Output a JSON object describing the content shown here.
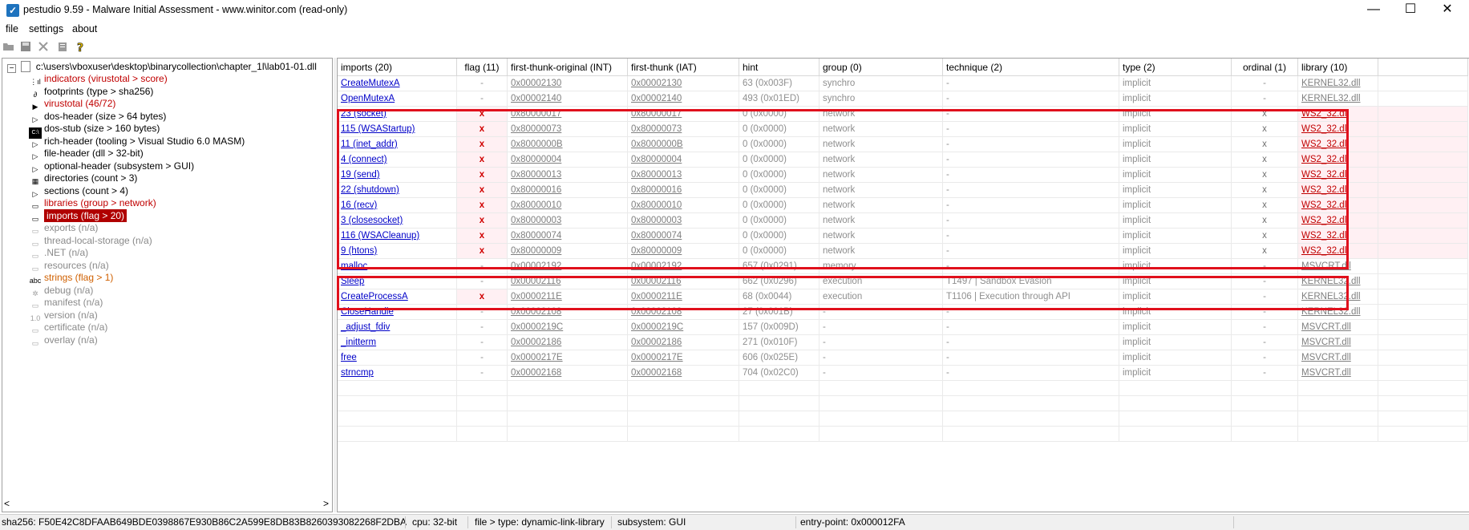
{
  "window": {
    "title": "pestudio 9.59 - Malware Initial Assessment - www.winitor.com (read-only)",
    "minimize": "—",
    "maximize": "☐",
    "close": "✕"
  },
  "menu": [
    "file",
    "settings",
    "about"
  ],
  "toolbar_icons": [
    "open-folder-icon",
    "save-icon",
    "close-file-icon",
    "clipboard-icon",
    "help-icon"
  ],
  "tree": {
    "root": "c:\\users\\vboxuser\\desktop\\binarycollection\\chapter_1l\\lab01-01.dll",
    "items": [
      {
        "label": "indicators (virustotal > score)",
        "style": "red",
        "icon": "indicators-icon"
      },
      {
        "label": "footprints (type > sha256)",
        "style": "normal",
        "icon": "footprints-icon"
      },
      {
        "label": "virustotal (46/72)",
        "style": "red",
        "icon": "virustotal-icon"
      },
      {
        "label": "dos-header (size > 64 bytes)",
        "style": "normal",
        "icon": "expand-arrow-icon"
      },
      {
        "label": "dos-stub (size > 160 bytes)",
        "style": "normal",
        "icon": "dos-stub-icon"
      },
      {
        "label": "rich-header (tooling > Visual Studio 6.0 MASM)",
        "style": "normal",
        "icon": "expand-arrow-icon"
      },
      {
        "label": "file-header (dll > 32-bit)",
        "style": "normal",
        "icon": "expand-arrow-icon"
      },
      {
        "label": "optional-header (subsystem > GUI)",
        "style": "normal",
        "icon": "expand-arrow-icon"
      },
      {
        "label": "directories (count > 3)",
        "style": "normal",
        "icon": "directories-icon"
      },
      {
        "label": "sections (count > 4)",
        "style": "normal",
        "icon": "expand-arrow-icon"
      },
      {
        "label": "libraries (group > network)",
        "style": "red",
        "icon": "libraries-icon"
      },
      {
        "label": "imports (flag > 20)",
        "style": "selected",
        "icon": "imports-icon"
      },
      {
        "label": "exports (n/a)",
        "style": "gray",
        "icon": "exports-icon"
      },
      {
        "label": "thread-local-storage (n/a)",
        "style": "gray",
        "icon": "tls-icon"
      },
      {
        "label": ".NET (n/a)",
        "style": "gray",
        "icon": "dotnet-icon"
      },
      {
        "label": "resources (n/a)",
        "style": "gray",
        "icon": "resources-icon"
      },
      {
        "label": "strings (flag > 1)",
        "style": "orange",
        "icon": "strings-icon"
      },
      {
        "label": "debug (n/a)",
        "style": "gray",
        "icon": "debug-icon"
      },
      {
        "label": "manifest (n/a)",
        "style": "gray",
        "icon": "manifest-icon"
      },
      {
        "label": "version (n/a)",
        "style": "gray",
        "icon": "version-icon"
      },
      {
        "label": "certificate (n/a)",
        "style": "gray",
        "icon": "certificate-icon"
      },
      {
        "label": "overlay (n/a)",
        "style": "gray",
        "icon": "overlay-icon"
      }
    ],
    "scroll_left": "<",
    "scroll_right": ">"
  },
  "table": {
    "columns": [
      "imports (20)",
      "flag (11)",
      "first-thunk-original (INT)",
      "first-thunk (IAT)",
      "hint",
      "group (0)",
      "technique (2)",
      "type (2)",
      "ordinal (1)",
      "library (10)"
    ],
    "rows": [
      {
        "name": "CreateMutexA",
        "flag": "-",
        "int": "0x00002130",
        "iat": "0x00002130",
        "hint": "63 (0x003F)",
        "group": "synchro",
        "technique": "-",
        "type": "implicit",
        "ordinal": "-",
        "library": "KERNEL32.dll",
        "kind": "normal"
      },
      {
        "name": "OpenMutexA",
        "flag": "-",
        "int": "0x00002140",
        "iat": "0x00002140",
        "hint": "493 (0x01ED)",
        "group": "synchro",
        "technique": "-",
        "type": "implicit",
        "ordinal": "-",
        "library": "KERNEL32.dll",
        "kind": "normal"
      },
      {
        "name": "23 (socket)",
        "flag": "x",
        "int": "0x80000017",
        "iat": "0x80000017",
        "hint": "0 (0x0000)",
        "group": "network",
        "technique": "-",
        "type": "implicit",
        "ordinal": "x",
        "library": "WS2_32.dll",
        "kind": "network"
      },
      {
        "name": "115 (WSAStartup)",
        "flag": "x",
        "int": "0x80000073",
        "iat": "0x80000073",
        "hint": "0 (0x0000)",
        "group": "network",
        "technique": "-",
        "type": "implicit",
        "ordinal": "x",
        "library": "WS2_32.dll",
        "kind": "network"
      },
      {
        "name": "11 (inet_addr)",
        "flag": "x",
        "int": "0x8000000B",
        "iat": "0x8000000B",
        "hint": "0 (0x0000)",
        "group": "network",
        "technique": "-",
        "type": "implicit",
        "ordinal": "x",
        "library": "WS2_32.dll",
        "kind": "network"
      },
      {
        "name": "4 (connect)",
        "flag": "x",
        "int": "0x80000004",
        "iat": "0x80000004",
        "hint": "0 (0x0000)",
        "group": "network",
        "technique": "-",
        "type": "implicit",
        "ordinal": "x",
        "library": "WS2_32.dll",
        "kind": "network"
      },
      {
        "name": "19 (send)",
        "flag": "x",
        "int": "0x80000013",
        "iat": "0x80000013",
        "hint": "0 (0x0000)",
        "group": "network",
        "technique": "-",
        "type": "implicit",
        "ordinal": "x",
        "library": "WS2_32.dll",
        "kind": "network"
      },
      {
        "name": "22 (shutdown)",
        "flag": "x",
        "int": "0x80000016",
        "iat": "0x80000016",
        "hint": "0 (0x0000)",
        "group": "network",
        "technique": "-",
        "type": "implicit",
        "ordinal": "x",
        "library": "WS2_32.dll",
        "kind": "network"
      },
      {
        "name": "16 (recv)",
        "flag": "x",
        "int": "0x80000010",
        "iat": "0x80000010",
        "hint": "0 (0x0000)",
        "group": "network",
        "technique": "-",
        "type": "implicit",
        "ordinal": "x",
        "library": "WS2_32.dll",
        "kind": "network"
      },
      {
        "name": "3 (closesocket)",
        "flag": "x",
        "int": "0x80000003",
        "iat": "0x80000003",
        "hint": "0 (0x0000)",
        "group": "network",
        "technique": "-",
        "type": "implicit",
        "ordinal": "x",
        "library": "WS2_32.dll",
        "kind": "network"
      },
      {
        "name": "116 (WSACleanup)",
        "flag": "x",
        "int": "0x80000074",
        "iat": "0x80000074",
        "hint": "0 (0x0000)",
        "group": "network",
        "technique": "-",
        "type": "implicit",
        "ordinal": "x",
        "library": "WS2_32.dll",
        "kind": "network"
      },
      {
        "name": "9 (htons)",
        "flag": "x",
        "int": "0x80000009",
        "iat": "0x80000009",
        "hint": "0 (0x0000)",
        "group": "network",
        "technique": "-",
        "type": "implicit",
        "ordinal": "x",
        "library": "WS2_32.dll",
        "kind": "network"
      },
      {
        "name": "malloc",
        "flag": "-",
        "int": "0x00002192",
        "iat": "0x00002192",
        "hint": "657 (0x0291)",
        "group": "memory",
        "technique": "-",
        "type": "implicit",
        "ordinal": "-",
        "library": "MSVCRT.dll",
        "kind": "normal"
      },
      {
        "name": "Sleep",
        "flag": "-",
        "int": "0x00002116",
        "iat": "0x00002116",
        "hint": "662 (0x0296)",
        "group": "execution",
        "technique": "T1497 | Sandbox Evasion",
        "type": "implicit",
        "ordinal": "-",
        "library": "KERNEL32.dll",
        "kind": "normal"
      },
      {
        "name": "CreateProcessA",
        "flag": "x",
        "int": "0x0000211E",
        "iat": "0x0000211E",
        "hint": "68 (0x0044)",
        "group": "execution",
        "technique": "T1106 | Execution through API",
        "type": "implicit",
        "ordinal": "-",
        "library": "KERNEL32.dll",
        "kind": "flagged"
      },
      {
        "name": "CloseHandle",
        "flag": "-",
        "int": "0x00002108",
        "iat": "0x00002108",
        "hint": "27 (0x001B)",
        "group": "-",
        "technique": "-",
        "type": "implicit",
        "ordinal": "-",
        "library": "KERNEL32.dll",
        "kind": "normal"
      },
      {
        "name": "_adjust_fdiv",
        "flag": "-",
        "int": "0x0000219C",
        "iat": "0x0000219C",
        "hint": "157 (0x009D)",
        "group": "-",
        "technique": "-",
        "type": "implicit",
        "ordinal": "-",
        "library": "MSVCRT.dll",
        "kind": "normal"
      },
      {
        "name": "_initterm",
        "flag": "-",
        "int": "0x00002186",
        "iat": "0x00002186",
        "hint": "271 (0x010F)",
        "group": "-",
        "technique": "-",
        "type": "implicit",
        "ordinal": "-",
        "library": "MSVCRT.dll",
        "kind": "normal"
      },
      {
        "name": "free",
        "flag": "-",
        "int": "0x0000217E",
        "iat": "0x0000217E",
        "hint": "606 (0x025E)",
        "group": "-",
        "technique": "-",
        "type": "implicit",
        "ordinal": "-",
        "library": "MSVCRT.dll",
        "kind": "normal"
      },
      {
        "name": "strncmp",
        "flag": "-",
        "int": "0x00002168",
        "iat": "0x00002168",
        "hint": "704 (0x02C0)",
        "group": "-",
        "technique": "-",
        "type": "implicit",
        "ordinal": "-",
        "library": "MSVCRT.dll",
        "kind": "normal"
      }
    ]
  },
  "status": {
    "sha256": "sha256: F50E42C8DFAAB649BDE0398867E930B86C2A599E8DB83B8260393082268F2DBA",
    "cpu": "cpu: 32-bit",
    "file_type": "file > type: dynamic-link-library",
    "subsystem": "subsystem: GUI",
    "entry_point": "entry-point: 0x000012FA"
  },
  "colors": {
    "accent_red": "#e0101c",
    "link_blue": "#0000c8",
    "tree_red": "#c00000",
    "selection": "#b00000"
  }
}
